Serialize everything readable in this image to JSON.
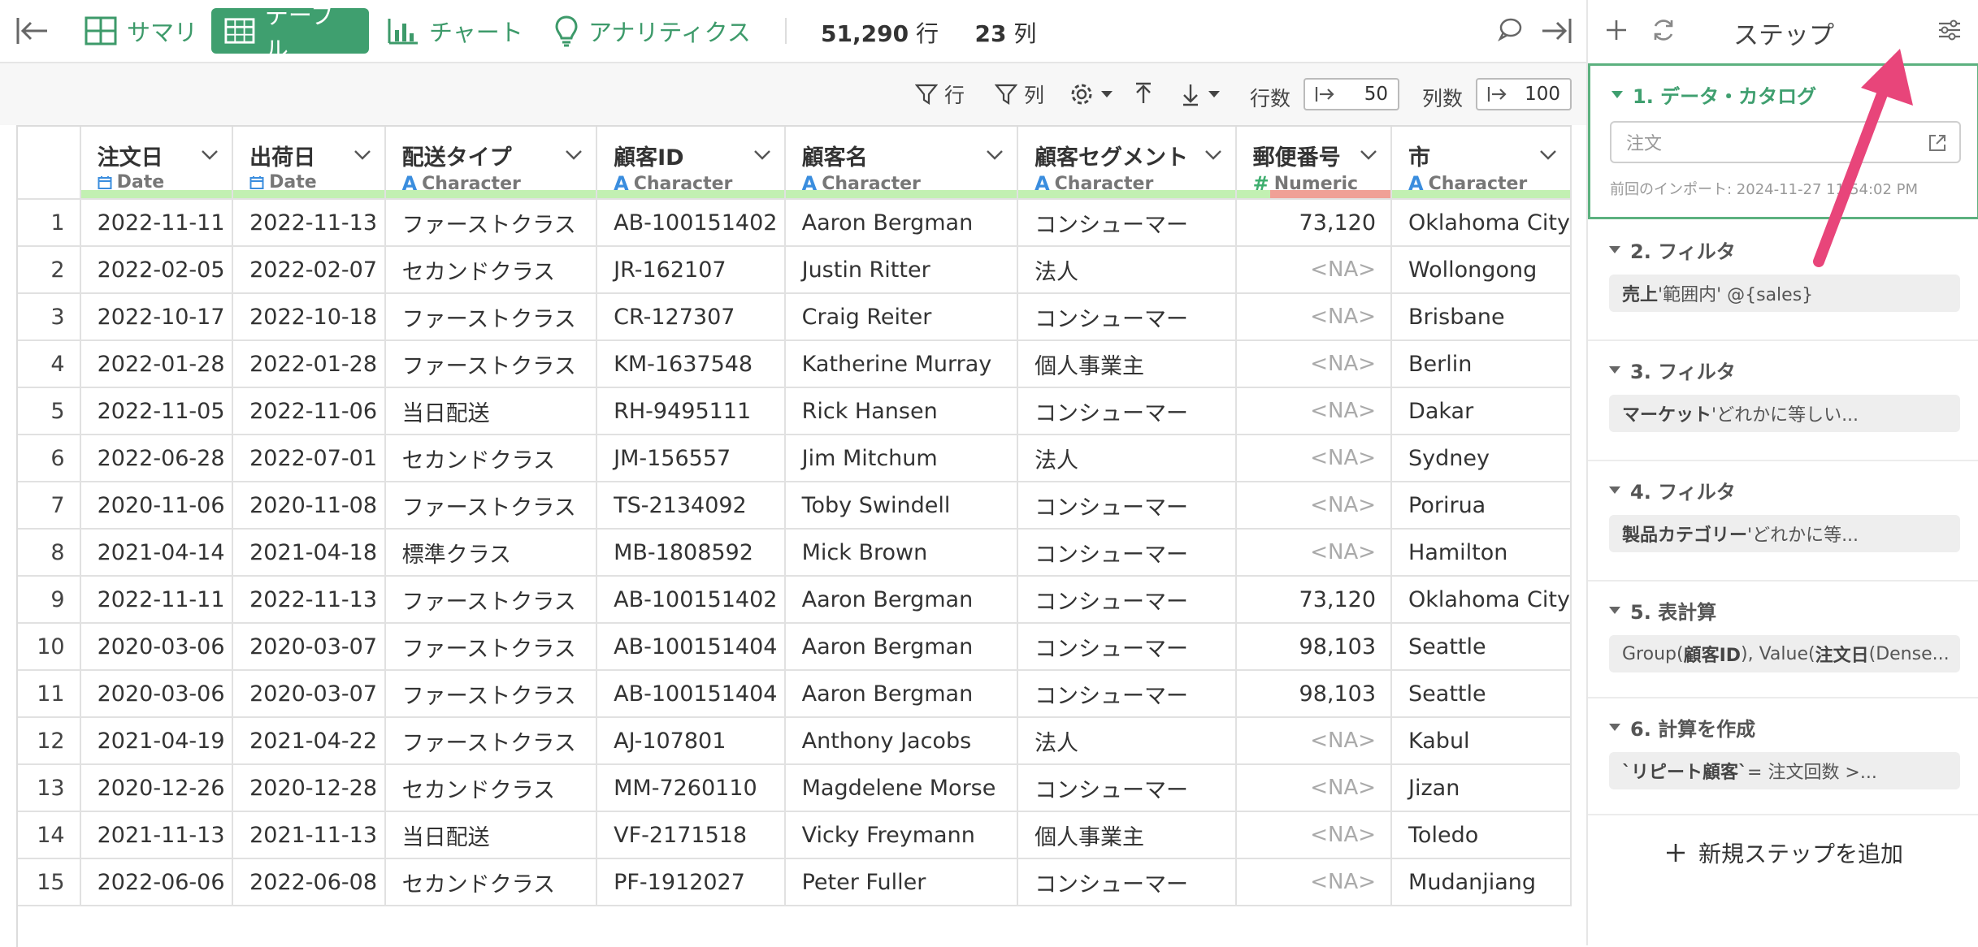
{
  "topbar": {
    "tabs": [
      {
        "label": "サマリ",
        "icon": "summary-grid-icon"
      },
      {
        "label": "テーブル",
        "icon": "table-icon",
        "active": true
      },
      {
        "label": "チャート",
        "icon": "bar-chart-icon"
      },
      {
        "label": "アナリティクス",
        "icon": "lightbulb-icon"
      }
    ],
    "row_count": "51,290",
    "row_unit": "行",
    "col_count": "23",
    "col_unit": "列"
  },
  "toolbar": {
    "row_filter_label": "行",
    "col_filter_label": "列",
    "rows_label": "行数",
    "rows_value": "50",
    "cols_label": "列数",
    "cols_value": "100"
  },
  "table": {
    "columns": [
      {
        "name": "注文日",
        "type": "Date",
        "type_icon": "calendar-icon"
      },
      {
        "name": "出荷日",
        "type": "Date",
        "type_icon": "calendar-icon"
      },
      {
        "name": "配送タイプ",
        "type": "Character",
        "type_icon": "A"
      },
      {
        "name": "顧客ID",
        "type": "Character",
        "type_icon": "A"
      },
      {
        "name": "顧客名",
        "type": "Character",
        "type_icon": "A"
      },
      {
        "name": "顧客セグメント",
        "type": "Character",
        "type_icon": "A"
      },
      {
        "name": "郵便番号",
        "type": "Numeric",
        "type_icon": "#"
      },
      {
        "name": "市",
        "type": "Character",
        "type_icon": "A"
      }
    ],
    "na": "<NA>",
    "rows": [
      [
        "1",
        "2022-11-11",
        "2022-11-13",
        "ファーストクラス",
        "AB-100151402",
        "Aaron Bergman",
        "コンシューマー",
        "73,120",
        "Oklahoma City"
      ],
      [
        "2",
        "2022-02-05",
        "2022-02-07",
        "セカンドクラス",
        "JR-162107",
        "Justin Ritter",
        "法人",
        "<NA>",
        "Wollongong"
      ],
      [
        "3",
        "2022-10-17",
        "2022-10-18",
        "ファーストクラス",
        "CR-127307",
        "Craig Reiter",
        "コンシューマー",
        "<NA>",
        "Brisbane"
      ],
      [
        "4",
        "2022-01-28",
        "2022-01-28",
        "ファーストクラス",
        "KM-1637548",
        "Katherine Murray",
        "個人事業主",
        "<NA>",
        "Berlin"
      ],
      [
        "5",
        "2022-11-05",
        "2022-11-06",
        "当日配送",
        "RH-9495111",
        "Rick Hansen",
        "コンシューマー",
        "<NA>",
        "Dakar"
      ],
      [
        "6",
        "2022-06-28",
        "2022-07-01",
        "セカンドクラス",
        "JM-156557",
        "Jim Mitchum",
        "法人",
        "<NA>",
        "Sydney"
      ],
      [
        "7",
        "2020-11-06",
        "2020-11-08",
        "ファーストクラス",
        "TS-2134092",
        "Toby Swindell",
        "コンシューマー",
        "<NA>",
        "Porirua"
      ],
      [
        "8",
        "2021-04-14",
        "2021-04-18",
        "標準クラス",
        "MB-1808592",
        "Mick Brown",
        "コンシューマー",
        "<NA>",
        "Hamilton"
      ],
      [
        "9",
        "2022-11-11",
        "2022-11-13",
        "ファーストクラス",
        "AB-100151402",
        "Aaron Bergman",
        "コンシューマー",
        "73,120",
        "Oklahoma City"
      ],
      [
        "10",
        "2020-03-06",
        "2020-03-07",
        "ファーストクラス",
        "AB-100151404",
        "Aaron Bergman",
        "コンシューマー",
        "98,103",
        "Seattle"
      ],
      [
        "11",
        "2020-03-06",
        "2020-03-07",
        "ファーストクラス",
        "AB-100151404",
        "Aaron Bergman",
        "コンシューマー",
        "98,103",
        "Seattle"
      ],
      [
        "12",
        "2021-04-19",
        "2021-04-22",
        "ファーストクラス",
        "AJ-107801",
        "Anthony Jacobs",
        "法人",
        "<NA>",
        "Kabul"
      ],
      [
        "13",
        "2020-12-26",
        "2020-12-28",
        "セカンドクラス",
        "MM-7260110",
        "Magdelene Morse",
        "コンシューマー",
        "<NA>",
        "Jizan"
      ],
      [
        "14",
        "2021-11-13",
        "2021-11-13",
        "当日配送",
        "VF-2171518",
        "Vicky Freymann",
        "個人事業主",
        "<NA>",
        "Toledo"
      ],
      [
        "15",
        "2022-06-06",
        "2022-06-08",
        "セカンドクラス",
        "PF-1912027",
        "Peter Fuller",
        "コンシューマー",
        "<NA>",
        "Mudanjiang"
      ]
    ]
  },
  "panel": {
    "title": "ステップ",
    "steps": [
      {
        "title": "1. データ・カタログ",
        "comment_placeholder": "注文",
        "import_note": "前回のインポート: 2024-11-27 11:54:02 PM"
      },
      {
        "title": "2. フィルタ",
        "pill_bold": "売上",
        "pill_rest": " '範囲内' @{sales}"
      },
      {
        "title": "3. フィルタ",
        "pill_bold": "マーケット",
        "pill_rest": " 'どれかに等しい..."
      },
      {
        "title": "4. フィルタ",
        "pill_bold": "製品カテゴリー",
        "pill_rest": " 'どれかに等..."
      },
      {
        "title": "5. 表計算",
        "pill_html": "Group(<b>顧客ID</b>), Value(<b>注文日</b> (Dense..."
      },
      {
        "title": "6. 計算を作成",
        "pill_bold": "`リピート顧客`",
        "pill_rest": " = 注文回数 >..."
      }
    ],
    "add_step_label": "新規ステップを追加"
  },
  "colors": {
    "accent": "#3f9f6f",
    "pointer": "#e8457a"
  }
}
